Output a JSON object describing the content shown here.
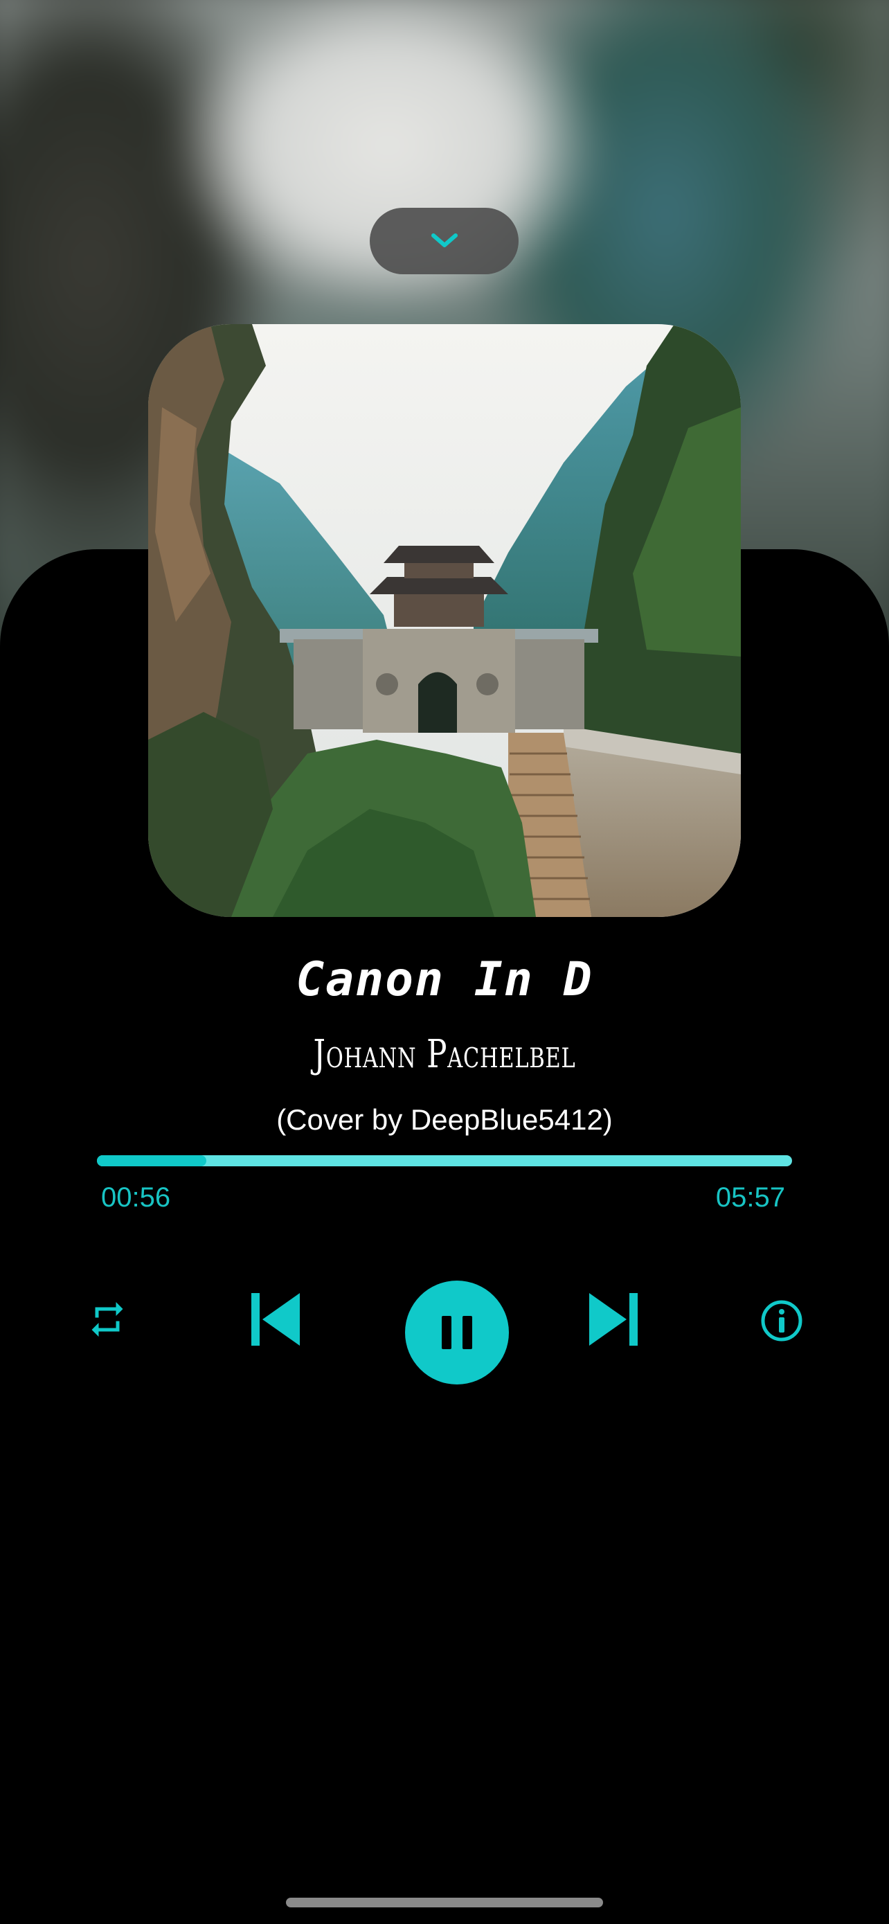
{
  "player": {
    "title": "Canon In D",
    "artist": "Johann Pachelbel",
    "subtitle": "(Cover by DeepBlue5412)",
    "elapsed": "00:56",
    "duration": "05:57",
    "progress_fraction": 0.157
  },
  "icons": {
    "collapse": "chevron-down-icon",
    "repeat": "repeat-icon",
    "previous": "skip-previous-icon",
    "play_pause": "pause-icon",
    "next": "skip-next-icon",
    "info": "info-icon"
  },
  "colors": {
    "accent": "#10c9c9",
    "track": "#5fe3e3",
    "background": "#000000",
    "text": "#ffffff"
  }
}
